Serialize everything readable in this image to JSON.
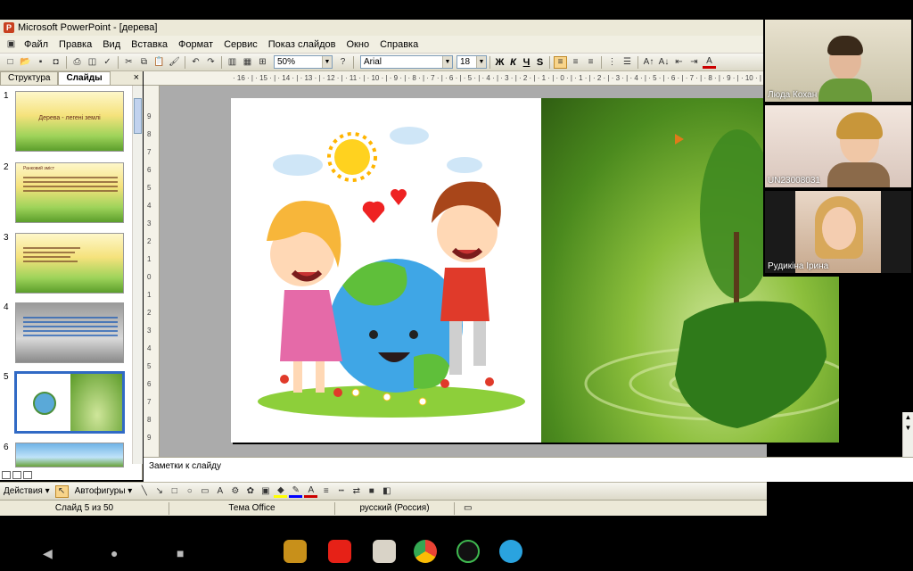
{
  "window": {
    "title": "Microsoft PowerPoint - [дерева]"
  },
  "menu": {
    "items": [
      "Файл",
      "Правка",
      "Вид",
      "Вставка",
      "Формат",
      "Сервис",
      "Показ слайдов",
      "Окно",
      "Справка"
    ]
  },
  "toolbar": {
    "zoom": "50%",
    "font_name": "Arial",
    "font_size": "18",
    "bold": "Ж",
    "italic": "К",
    "underline": "Ч",
    "shadow": "S"
  },
  "left_pane": {
    "tab_outline": "Структура",
    "tab_slides": "Слайды",
    "close": "×",
    "slides": [
      {
        "num": "1",
        "title": "Дерева - легені землі"
      },
      {
        "num": "2",
        "title": "Ранковий зміст"
      },
      {
        "num": "3",
        "title": ""
      },
      {
        "num": "4",
        "title": ""
      },
      {
        "num": "5",
        "title": ""
      },
      {
        "num": "6",
        "title": ""
      }
    ]
  },
  "ruler": {
    "h_ticks": "· 16 · | · 15 · | · 14 · | · 13 · | · 12 · | · 11 · | · 10 · | · 9 · | · 8 · | · 7 · | · 6 · | · 5 · | · 4 · | · 3 · | · 2 · | · 1 · | · 0 · | · 1 · | · 2 · | · 3 · | · 4 · | · 5 · | · 6 · | · 7 · | · 8 · | · 9 · | · 10 · | · 11 · | · 12 ·",
    "v_ticks": [
      "9",
      "8",
      "7",
      "6",
      "5",
      "4",
      "3",
      "2",
      "1",
      "0",
      "1",
      "2",
      "3",
      "4",
      "5",
      "6",
      "7",
      "8",
      "9"
    ]
  },
  "notes": {
    "placeholder": "Заметки к слайду"
  },
  "drawbar": {
    "actions": "Действия ▾",
    "autoshapes": "Автофигуры ▾"
  },
  "status": {
    "slide": "Слайд 5 из 50",
    "theme": "Тема Office",
    "language": "русский (Россия)"
  },
  "video": {
    "participants": [
      {
        "name": "Люда Кохан"
      },
      {
        "name": "UN23008031"
      },
      {
        "name": "Рудикіна Ірина"
      }
    ]
  },
  "colors": {
    "selection": "#316ac5",
    "office_bg": "#ece9d8",
    "slide_green": "#5c9e2b"
  }
}
